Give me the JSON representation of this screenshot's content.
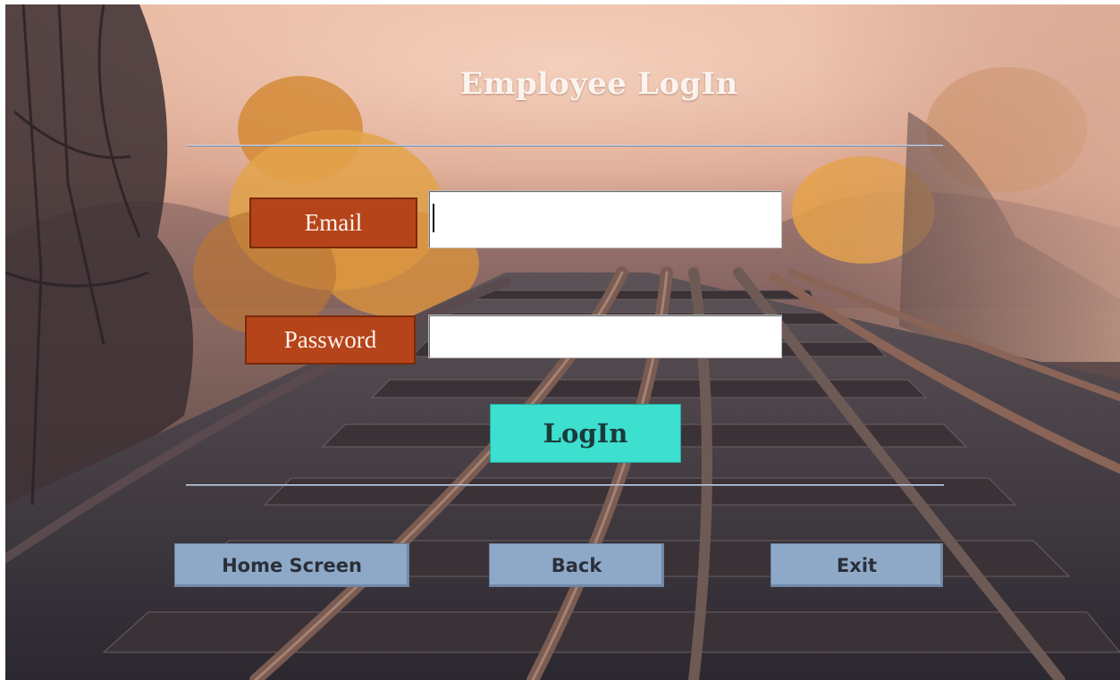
{
  "header": {
    "title": "Employee LogIn"
  },
  "form": {
    "email_label": "Email",
    "email_value": "",
    "password_label": "Password",
    "password_value": "",
    "login_label": "LogIn"
  },
  "nav": {
    "home_label": "Home Screen",
    "back_label": "Back",
    "exit_label": "Exit"
  },
  "colors": {
    "label_bg": "#b5441a",
    "login_bg": "#3ddfcf",
    "nav_bg": "#8ea9c8",
    "title": "#fbf3ee"
  },
  "background": {
    "scene": "railway-bridge-autumn-forest"
  }
}
